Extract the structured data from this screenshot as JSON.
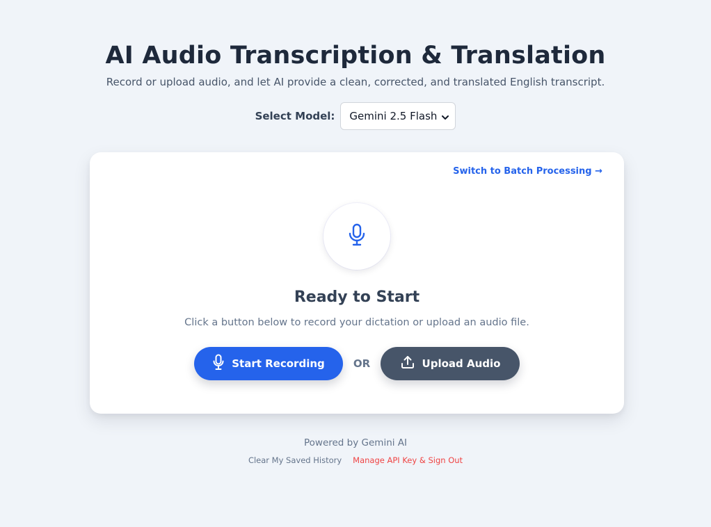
{
  "header": {
    "title": "AI Audio Transcription & Translation",
    "subtitle": "Record or upload audio, and let AI provide a clean, corrected, and translated English transcript."
  },
  "model": {
    "label": "Select Model:",
    "selected": "Gemini 2.5 Flash"
  },
  "card": {
    "batch_link": "Switch to Batch Processing →",
    "status_title": "Ready to Start",
    "status_subtitle": "Click a button below to record your dictation or upload an audio file.",
    "record_label": "Start Recording",
    "or_label": "OR",
    "upload_label": "Upload Audio"
  },
  "footer": {
    "powered": "Powered by Gemini AI",
    "clear_history": "Clear My Saved History",
    "sign_out": "Manage API Key & Sign Out"
  },
  "icons": {
    "mic": "microphone-icon",
    "upload": "upload-icon",
    "chevron": "chevron-down-icon"
  },
  "colors": {
    "accent": "#2563eb",
    "upload_button": "#475569",
    "danger_link": "#ef4444",
    "background": "#f0f4f9"
  }
}
